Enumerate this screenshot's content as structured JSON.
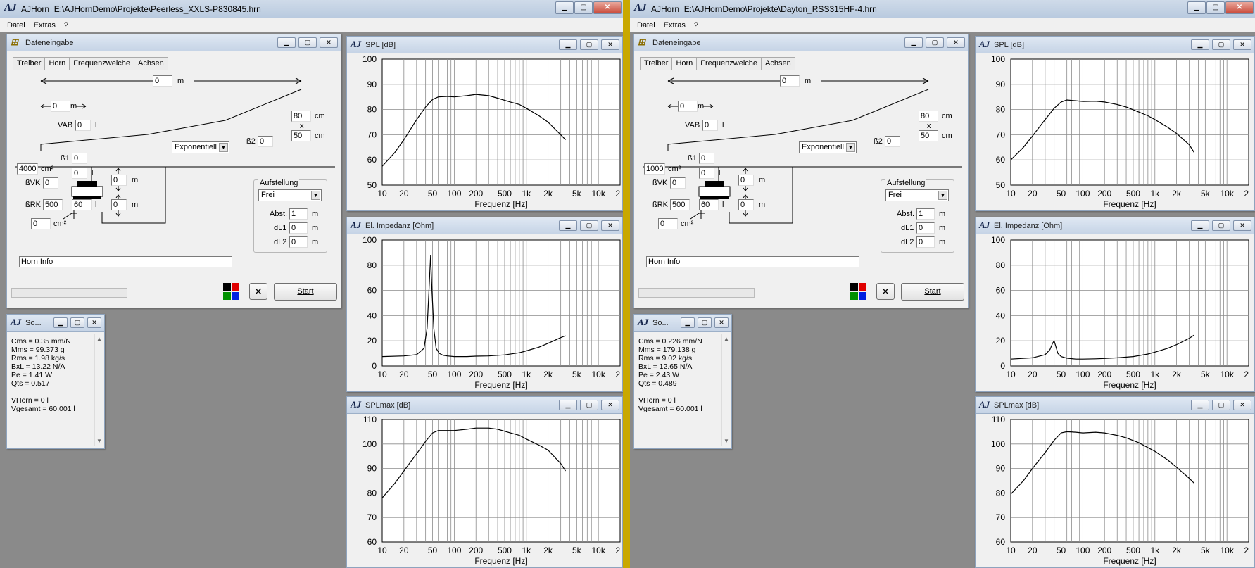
{
  "colors": {
    "accent": "#c9a800",
    "titlebar": "#c6d4e6"
  },
  "windows": [
    {
      "app_title": "AJHorn",
      "file_path": "E:\\AJHornDemo\\Projekte\\Peerless_XXLS-P830845.hrn",
      "menu": [
        "Datei",
        "Extras",
        "?"
      ],
      "input": {
        "title": "Dateneingabe",
        "tabs": [
          "Treiber",
          "Horn",
          "Frequenzweiche",
          "Achsen"
        ],
        "length": "0",
        "length_unit": "m",
        "offset": "0",
        "offset_unit": "m",
        "vab_label": "VAB",
        "vab": "0",
        "vab_unit": "l",
        "width": "80",
        "width_unit": "cm",
        "x": "x",
        "height": "50",
        "height_unit": "cm",
        "b2_label": "ß2",
        "b2": "0",
        "flare": "Exponentiell",
        "b1_label": "ß1",
        "b1": "0",
        "throat": "4000",
        "throat_unit": "cm²",
        "vol1": "0",
        "vol1_unit": "l",
        "bvk_label": "ßVK",
        "bvk": "0",
        "m1": "0",
        "m1_unit": "m",
        "brk_label": "ßRK",
        "brk": "500",
        "vol2": "60",
        "vol2_unit": "l",
        "m2": "0",
        "m2_unit": "m",
        "port": "0",
        "port_unit": "cm²",
        "aufstellung": "Aufstellung",
        "frei": "Frei",
        "abst_label": "Abst.",
        "abst": "1",
        "abst_unit": "m",
        "dl1_label": "dL1",
        "dl1": "0",
        "dl1_unit": "m",
        "dl2_label": "dL2",
        "dl2": "0",
        "dl2_unit": "m",
        "horninfo": "Horn Info",
        "start": "Start",
        "close": "✕"
      },
      "info": {
        "title": "So...",
        "text": "Cms = 0.35 mm/N\nMms = 99.373 g\nRms = 1.98 kg/s\nBxL = 13.22 N/A\nPe = 1.41 W\nQts = 0.517\n\nVHorn = 0 l\nVgesamt = 60.001 l"
      }
    },
    {
      "app_title": "AJHorn",
      "file_path": "E:\\AJHornDemo\\Projekte\\Dayton_RSS315HF-4.hrn",
      "menu": [
        "Datei",
        "Extras",
        "?"
      ],
      "input": {
        "title": "Dateneingabe",
        "tabs": [
          "Treiber",
          "Horn",
          "Frequenzweiche",
          "Achsen"
        ],
        "length": "0",
        "length_unit": "m",
        "offset": "0",
        "offset_unit": "m",
        "vab_label": "VAB",
        "vab": "0",
        "vab_unit": "l",
        "width": "80",
        "width_unit": "cm",
        "x": "x",
        "height": "50",
        "height_unit": "cm",
        "b2_label": "ß2",
        "b2": "0",
        "flare": "Exponentiell",
        "b1_label": "ß1",
        "b1": "0",
        "throat": "1000",
        "throat_unit": "cm²",
        "vol1": "0",
        "vol1_unit": "l",
        "bvk_label": "ßVK",
        "bvk": "0",
        "m1": "0",
        "m1_unit": "m",
        "brk_label": "ßRK",
        "brk": "500",
        "vol2": "60",
        "vol2_unit": "l",
        "m2": "0",
        "m2_unit": "m",
        "port": "0",
        "port_unit": "cm²",
        "aufstellung": "Aufstellung",
        "frei": "Frei",
        "abst_label": "Abst.",
        "abst": "1",
        "abst_unit": "m",
        "dl1_label": "dL1",
        "dl1": "0",
        "dl1_unit": "m",
        "dl2_label": "dL2",
        "dl2": "0",
        "dl2_unit": "m",
        "horninfo": "Horn Info",
        "start": "Start",
        "close": "✕"
      },
      "info": {
        "title": "So...",
        "text": "Cms = 0.226 mm/N\nMms = 179.138 g\nRms = 9.02 kg/s\nBxL = 12.65 N/A\nPe = 2.43 W\nQts = 0.489\n\nVHorn = 0 l\nVgesamt = 60.001 l"
      }
    }
  ],
  "chart_data": [
    {
      "window": 0,
      "type": "line",
      "title": "SPL [dB]",
      "xlabel": "Frequenz [Hz]",
      "xscale": "log",
      "xlim": [
        10,
        20000
      ],
      "ylim": [
        50,
        100
      ],
      "xticks": [
        "10",
        "20",
        "50",
        "100",
        "200",
        "500",
        "1k",
        "2k",
        "5k",
        "10k",
        "2"
      ],
      "yticks": [
        50,
        60,
        70,
        80,
        90,
        100
      ],
      "x": [
        10,
        15,
        20,
        30,
        40,
        50,
        60,
        80,
        100,
        150,
        200,
        300,
        400,
        600,
        800,
        1000,
        1500,
        2000,
        3000,
        3500
      ],
      "y": [
        57.5,
        63,
        68,
        76,
        81,
        84,
        85,
        85.2,
        85,
        85.5,
        86,
        85.5,
        84.5,
        83,
        82,
        80.5,
        77.5,
        75,
        70,
        68
      ]
    },
    {
      "window": 0,
      "type": "line",
      "title": "El. Impedanz [Ohm]",
      "xlabel": "Frequenz [Hz]",
      "xscale": "log",
      "xlim": [
        10,
        20000
      ],
      "ylim": [
        0,
        100
      ],
      "xticks": [
        "10",
        "20",
        "50",
        "100",
        "200",
        "500",
        "1k",
        "2k",
        "5k",
        "10k",
        "2"
      ],
      "yticks": [
        0,
        20,
        40,
        60,
        80,
        100
      ],
      "x": [
        10,
        20,
        30,
        38,
        42,
        45,
        47,
        49,
        52,
        56,
        62,
        70,
        80,
        100,
        150,
        200,
        300,
        500,
        800,
        1000,
        1500,
        2000,
        3000,
        3500
      ],
      "y": [
        7.5,
        8,
        9,
        14,
        30,
        65,
        88,
        60,
        30,
        14,
        10,
        8.5,
        8,
        7.5,
        7.5,
        7.8,
        8,
        8.8,
        10.5,
        12,
        15,
        18,
        22.5,
        24
      ]
    },
    {
      "window": 0,
      "type": "line",
      "title": "SPLmax [dB]",
      "xlabel": "Frequenz [Hz]",
      "xscale": "log",
      "xlim": [
        10,
        20000
      ],
      "ylim": [
        60,
        110
      ],
      "xticks": [
        "10",
        "20",
        "50",
        "100",
        "200",
        "500",
        "1k",
        "2k",
        "5k",
        "10k",
        "2"
      ],
      "yticks": [
        60,
        70,
        80,
        90,
        100,
        110
      ],
      "x": [
        10,
        15,
        20,
        30,
        40,
        50,
        60,
        80,
        100,
        150,
        200,
        300,
        400,
        600,
        800,
        1000,
        1500,
        2000,
        3000,
        3500
      ],
      "y": [
        78,
        84,
        89,
        96,
        101,
        104.5,
        105.5,
        105.5,
        105.5,
        106,
        106.5,
        106.5,
        106,
        104.5,
        103.5,
        102,
        99.5,
        97.5,
        92,
        89
      ]
    },
    {
      "window": 1,
      "type": "line",
      "title": "SPL [dB]",
      "xlabel": "Frequenz [Hz]",
      "xscale": "log",
      "xlim": [
        10,
        20000
      ],
      "ylim": [
        50,
        100
      ],
      "xticks": [
        "10",
        "20",
        "50",
        "100",
        "200",
        "500",
        "1k",
        "2k",
        "5k",
        "10k",
        "2"
      ],
      "yticks": [
        50,
        60,
        70,
        80,
        90,
        100
      ],
      "x": [
        10,
        15,
        20,
        30,
        40,
        50,
        60,
        80,
        100,
        150,
        200,
        300,
        400,
        600,
        800,
        1000,
        1500,
        2000,
        3000,
        3500
      ],
      "y": [
        60,
        65,
        69.5,
        76,
        80.5,
        83,
        83.8,
        83.5,
        83.2,
        83.3,
        83,
        82,
        81,
        79,
        77.5,
        76,
        73,
        70.5,
        66,
        63
      ]
    },
    {
      "window": 1,
      "type": "line",
      "title": "El. Impedanz [Ohm]",
      "xlabel": "Frequenz [Hz]",
      "xscale": "log",
      "xlim": [
        10,
        20000
      ],
      "ylim": [
        0,
        100
      ],
      "xticks": [
        "10",
        "20",
        "50",
        "100",
        "200",
        "500",
        "1k",
        "2k",
        "5k",
        "10k",
        "2"
      ],
      "yticks": [
        0,
        20,
        40,
        60,
        80,
        100
      ],
      "x": [
        10,
        20,
        30,
        35,
        38,
        40,
        42,
        45,
        50,
        60,
        80,
        100,
        150,
        200,
        300,
        500,
        800,
        1000,
        1500,
        2000,
        3000,
        3500
      ],
      "y": [
        5.5,
        6.5,
        9,
        13,
        18,
        20,
        16,
        10,
        7.5,
        6.2,
        5.5,
        5.5,
        5.7,
        6,
        6.5,
        7.5,
        9.5,
        11,
        14,
        17,
        22,
        24.5
      ]
    },
    {
      "window": 1,
      "type": "line",
      "title": "SPLmax [dB]",
      "xlabel": "Frequenz [Hz]",
      "xscale": "log",
      "xlim": [
        10,
        20000
      ],
      "ylim": [
        60,
        110
      ],
      "xticks": [
        "10",
        "20",
        "50",
        "100",
        "200",
        "500",
        "1k",
        "2k",
        "5k",
        "10k",
        "2"
      ],
      "yticks": [
        60,
        70,
        80,
        90,
        100,
        110
      ],
      "x": [
        10,
        15,
        20,
        30,
        40,
        50,
        60,
        80,
        100,
        150,
        200,
        300,
        400,
        600,
        800,
        1000,
        1500,
        2000,
        3000,
        3500
      ],
      "y": [
        79.5,
        85,
        90,
        96.5,
        101.5,
        104.5,
        105,
        104.8,
        104.5,
        104.8,
        104.5,
        103.5,
        102.5,
        100.5,
        98.5,
        97,
        93.5,
        90.5,
        86,
        84
      ]
    }
  ]
}
